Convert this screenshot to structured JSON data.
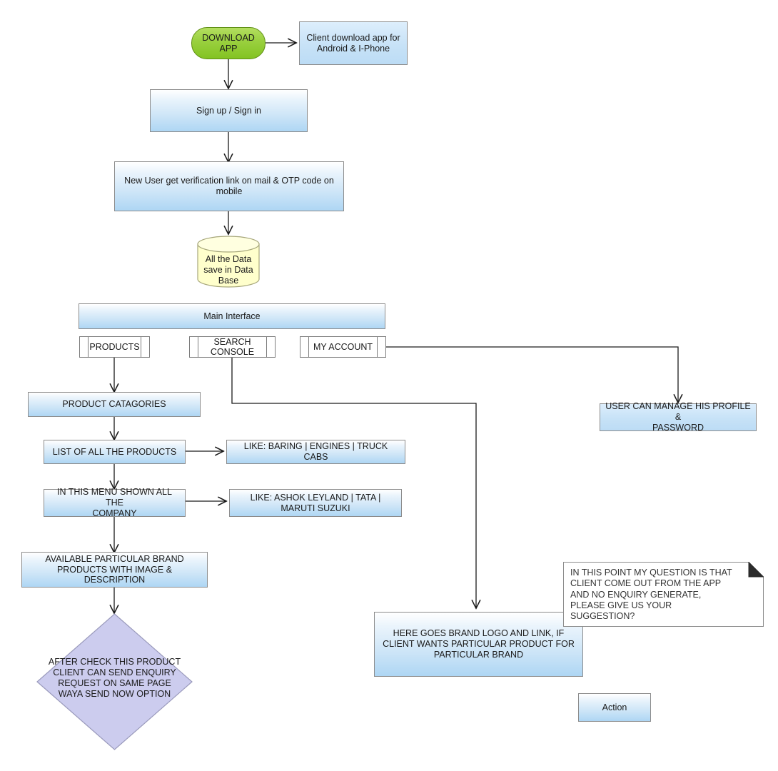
{
  "diagram": {
    "title": "Mobile App User Flow Diagram",
    "colors": {
      "process_fill_top": "#ffffff",
      "process_fill_bottom": "#aed6f4",
      "process_border": "#8c8c8c",
      "terminator_fill": "#83c322",
      "terminator_border": "#5f8f14",
      "database_fill": "#ffffcc",
      "database_border": "#a6a67a",
      "decision_fill": "#ccccee",
      "decision_border": "#8f8fb0",
      "note_fill": "#ffffff",
      "note_border": "#8c8c8c",
      "note_fold": "#2b2b2b",
      "connector": "#1a1a1a",
      "predefined_fill": "#ffffff",
      "predefined_border": "#7d7d7d"
    },
    "nodes": {
      "download_app": {
        "label": "DOWNLOAD\nAPP",
        "shape": "terminator"
      },
      "client_download": {
        "label": "Client download app for\nAndroid & I-Phone",
        "shape": "process"
      },
      "sign_up_in": {
        "label": "Sign up / Sign in",
        "shape": "process"
      },
      "verification": {
        "label": "New User get verification link on mail & OTP code on\nmobile",
        "shape": "process"
      },
      "database": {
        "label": "All the Data\nsave in Data\nBase",
        "shape": "database"
      },
      "main_interface": {
        "label": "Main Interface",
        "shape": "process"
      },
      "products": {
        "label": "PRODUCTS",
        "shape": "predefined-process"
      },
      "search_console": {
        "label": "SEARCH\nCONSOLE",
        "shape": "predefined-process"
      },
      "my_account": {
        "label": "MY ACCOUNT",
        "shape": "predefined-process"
      },
      "product_categories": {
        "label": "PRODUCT CATAGORIES",
        "shape": "process"
      },
      "list_products": {
        "label": "LIST OF ALL THE PRODUCTS",
        "shape": "process"
      },
      "like_baring": {
        "label": "LIKE: BARING | ENGINES | TRUCK CABS",
        "shape": "process"
      },
      "menu_company": {
        "label": "IN THIS MENU SHOWN ALL THE\nCOMPANY",
        "shape": "process"
      },
      "like_ashok": {
        "label": "LIKE: ASHOK LEYLAND | TATA |\nMARUTI SUZUKI",
        "shape": "process"
      },
      "available_brand": {
        "label": "AVAILABLE PARTICULAR BRAND\nPRODUCTS WITH IMAGE & DESCRIPTION",
        "shape": "process"
      },
      "enquiry_decision": {
        "label": "AFTER CHECK THIS PRODUCT\nCLIENT CAN SEND ENQUIRY\nREQUEST ON SAME PAGE\nWAYA SEND NOW OPTION",
        "shape": "decision"
      },
      "manage_profile": {
        "label": "USER CAN MANAGE HIS PROFILE &\nPASSWORD",
        "shape": "process"
      },
      "brand_logo": {
        "label": "HERE GOES BRAND LOGO AND LINK, IF\nCLIENT WANTS PARTICULAR PRODUCT FOR\nPARTICULAR BRAND",
        "shape": "process"
      },
      "question_note": {
        "label": "IN THIS POINT MY QUESTION IS THAT\nCLIENT COME OUT FROM THE APP\nAND NO ENQUIRY GENERATE,\nPLEASE GIVE US YOUR\nSUGGESTION?",
        "shape": "note"
      },
      "action": {
        "label": "Action",
        "shape": "process"
      }
    }
  }
}
